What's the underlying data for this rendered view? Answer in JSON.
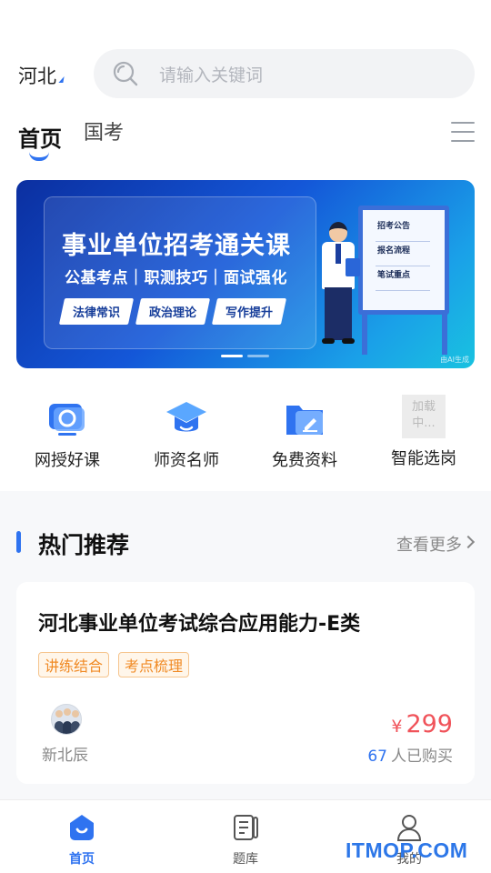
{
  "header": {
    "city": "河北",
    "search_placeholder": "请输入关键词"
  },
  "tabs": [
    {
      "label": "首页",
      "active": true
    },
    {
      "label": "国考",
      "active": false
    }
  ],
  "banner": {
    "title": "事业单位招考通关课",
    "subtitle": "公基考点｜职测技巧｜面试强化",
    "chips": [
      "法律常识",
      "政治理论",
      "写作提升"
    ],
    "board_lines": [
      "招考公告",
      "报名流程",
      "笔试重点"
    ],
    "ai_label": "由AI生成",
    "slide_count": 2,
    "active_slide": 1
  },
  "quick_menu": [
    {
      "label": "网授好课",
      "icon": "monitor-icon"
    },
    {
      "label": "师资名师",
      "icon": "graduation-cap-icon"
    },
    {
      "label": "免费资料",
      "icon": "folder-icon"
    },
    {
      "label": "智能选岗",
      "icon": "loading-placeholder",
      "placeholder_text": "加载中..."
    }
  ],
  "hot": {
    "title": "热门推荐",
    "more_label": "查看更多"
  },
  "course": {
    "title": "河北事业单位考试综合应用能力-E类",
    "tags": [
      "讲练结合",
      "考点梳理"
    ],
    "teacher": "新北辰",
    "currency": "¥",
    "price": "299",
    "buyers_count": "67",
    "buyers_suffix": "人已购买"
  },
  "bottom_nav": [
    {
      "label": "首页",
      "icon": "home-icon",
      "active": true
    },
    {
      "label": "题库",
      "icon": "question-bank-icon",
      "active": false
    },
    {
      "label": "我的",
      "icon": "profile-icon",
      "active": false
    }
  ],
  "watermark": "ITMOP.COM",
  "colors": {
    "accent": "#2f73f0",
    "price": "#f0535a",
    "tag": "#f08a24"
  }
}
